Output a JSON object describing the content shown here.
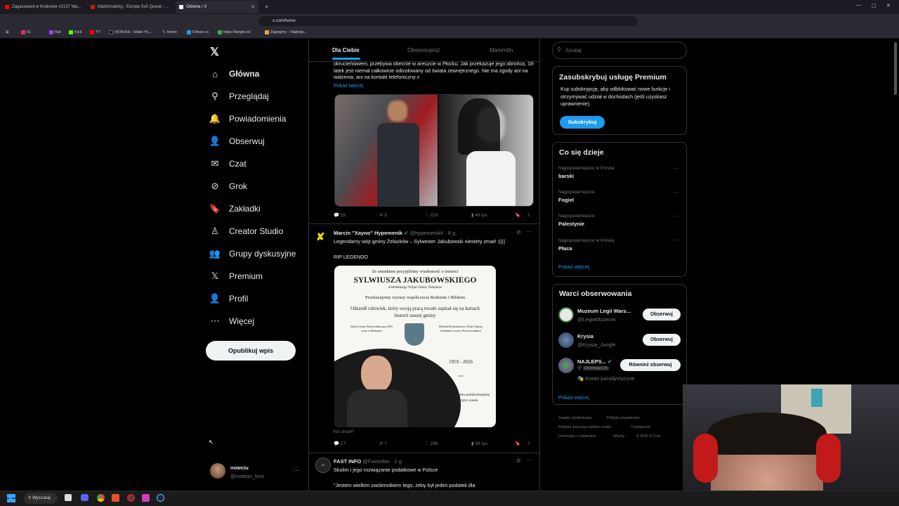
{
  "browser": {
    "tabs": [
      {
        "title": "Zagazowani w Krakowie #2137 Wa...",
        "color": "#ff0000"
      },
      {
        "title": "Matchmaking - Europe 5v5 Queue - ...",
        "color": "#cc2200"
      },
      {
        "title": "Główna / X",
        "color": "#ffffff"
      }
    ],
    "url": "x.com/home",
    "bookmarks": [
      "IG",
      "Rat",
      "Kick",
      "YT",
      "(4)TikTok - Make Yo...",
      "Home",
      "Filman.cc",
      "https://tangle.io/",
      "Zagrajmy – Najleps..."
    ]
  },
  "nav": {
    "items": [
      {
        "label": "Główna",
        "icon": "home-icon",
        "glyph": "⌂"
      },
      {
        "label": "Przeglądaj",
        "icon": "search-icon",
        "glyph": "⚲"
      },
      {
        "label": "Powiadomienia",
        "icon": "bell-icon",
        "glyph": "🔔"
      },
      {
        "label": "Obserwuj",
        "icon": "follow-icon",
        "glyph": "👤"
      },
      {
        "label": "Czat",
        "icon": "mail-icon",
        "glyph": "✉"
      },
      {
        "label": "Grok",
        "icon": "grok-icon",
        "glyph": "⊘"
      },
      {
        "label": "Zakładki",
        "icon": "bookmark-icon",
        "glyph": "🔖"
      },
      {
        "label": "Creator Studio",
        "icon": "creator-icon",
        "glyph": "♙"
      },
      {
        "label": "Grupy dyskusyjne",
        "icon": "groups-icon",
        "glyph": "👥"
      },
      {
        "label": "Premium",
        "icon": "x-premium-icon",
        "glyph": "𝕏"
      },
      {
        "label": "Profil",
        "icon": "profile-icon",
        "glyph": "👤"
      },
      {
        "label": "Więcej",
        "icon": "more-icon",
        "glyph": "⋯"
      }
    ],
    "post_button": "Opublikuj wpis",
    "account": {
      "name": "nowciu",
      "handle": "@nowciu_kick"
    }
  },
  "feed": {
    "tabs": [
      "Dla Ciebie",
      "Obserwujesz",
      "Mamm0n"
    ],
    "tweet1": {
      "text": "okrucieństwem, przebywa obecnie w areszcie w Płocku. Jak przekazuje jego obrońca, 18-latek jest niemal całkowicie odizolowany od świata zewnętrznego. Nie ma zgody ani na widzenia, ani na kontakt telefoniczny z",
      "more": "Pokaż więcej",
      "replies": "55",
      "reposts": "5",
      "likes": "223",
      "views": "46 tys."
    },
    "tweet2": {
      "author": "Marcin \"Xayoo\" Hypemenik",
      "handle": "@hypemenikk · 8 g.",
      "text": "Legendarny wójt gminy Żelazków – Sylwester Jakubowski niestety zmarł :((((",
      "text2": "RIP LEGENDO",
      "image_caption": "Kto umarł?",
      "obituary": {
        "line1": "Ze smutkiem przyjęliśmy wiadomość o śmierci",
        "name": "SYLWIUSZA JAKUBOWSKIEGO",
        "role": "wieloletniego Wójta Gminy Żelazków",
        "line2": "Przekazujemy wyrazy współczucia Rodzinie i Bliskim",
        "line3": "Odszedł człowiek, który swoją pracą trwale zapisał się na kartach historii naszej gminy",
        "left_sign": "Józef Lesisy Przewodniczący RG wraz z Radnymi",
        "right_sign": "Michał Kraszkiewicz Wójt Gminy Żelazków wraz z Pracownikami",
        "years": "1959 - 2026",
        "footer": "O terminie pogrzebu poinformujemy w najbliższym czasie"
      },
      "replies": "17",
      "reposts": "7",
      "likes": "296",
      "views": "58 tys."
    },
    "tweet3": {
      "author": "FAST INFO",
      "handle": "@Fastinfoo · 1 g.",
      "text": "Skolim i jego rozwiązanie podatkowe w Polsce",
      "text2": "\"Jestem wielkim zwolennikiem tego, żeby był jeden podatek dla"
    }
  },
  "right": {
    "search_placeholder": "Szukaj",
    "premium": {
      "title": "Zasubskrybuj usługę Premium",
      "body": "Kup subskrypcję, aby odblokować nowe funkcje i otrzymywać udział w dochodach (jeśli uzyskasz uprawnienie).",
      "button": "Subskrybuj"
    },
    "trends": {
      "title": "Co się dzieje",
      "items": [
        {
          "context": "Najpopularniejsze w Polska",
          "name": "barski"
        },
        {
          "context": "Najpopularniejsze",
          "name": "Fogiel"
        },
        {
          "context": "Najpopularniejsze",
          "name": "Palestynie"
        },
        {
          "context": "Najpopularniejsze w Polska",
          "name": "Płaca"
        }
      ],
      "more": "Pokaż więcej"
    },
    "who_to_follow": {
      "title": "Warci obserwowania",
      "items": [
        {
          "name": "Muzeum Legii Wars...",
          "handle": "@LegiaMuzeum",
          "button": "Obserwuj"
        },
        {
          "name": "Krysia",
          "handle": "@Krysia_Jungle",
          "button": "Obserwuj"
        },
        {
          "name": "NAJLEPS...",
          "handle": "@",
          "badge": "Obserwuje Cię",
          "note": "Konto parodystyczne",
          "button": "Również obserwuj"
        }
      ],
      "more": "Pokaż więcej"
    },
    "footer": [
      "Zasady użytkowania",
      "Polityka prywatności",
      "Polityka dotycząca plików cookie",
      "Dostępność",
      "Informacje o reklamach",
      "Więcej ···",
      "© 2026 X Corp."
    ]
  },
  "taskbar": {
    "search": "Wyszukaj"
  }
}
